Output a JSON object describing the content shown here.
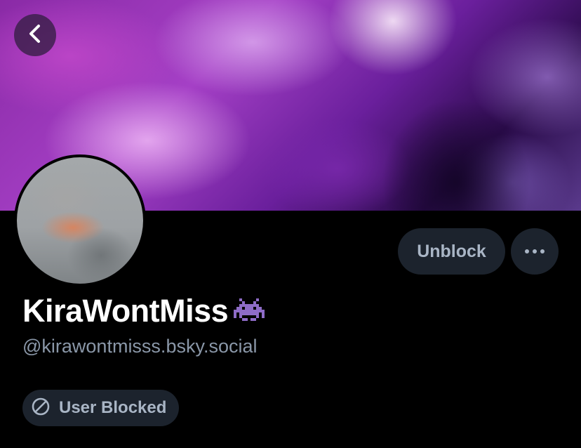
{
  "profile": {
    "display_name": "KiraWontMiss",
    "name_emoji": "alien-monster-emoji",
    "handle": "@kirawontmisss.bsky.social",
    "status_badge": "User Blocked"
  },
  "actions": {
    "unblock_label": "Unblock",
    "more_icon": "ellipsis-icon",
    "back_icon": "chevron-left-icon"
  },
  "colors": {
    "background": "#000000",
    "button_bg": "#1c232d",
    "button_text": "#a9b5c5",
    "handle_text": "#8a97a8",
    "name_text": "#ffffff",
    "emoji_purple": "#8e6cc7"
  }
}
